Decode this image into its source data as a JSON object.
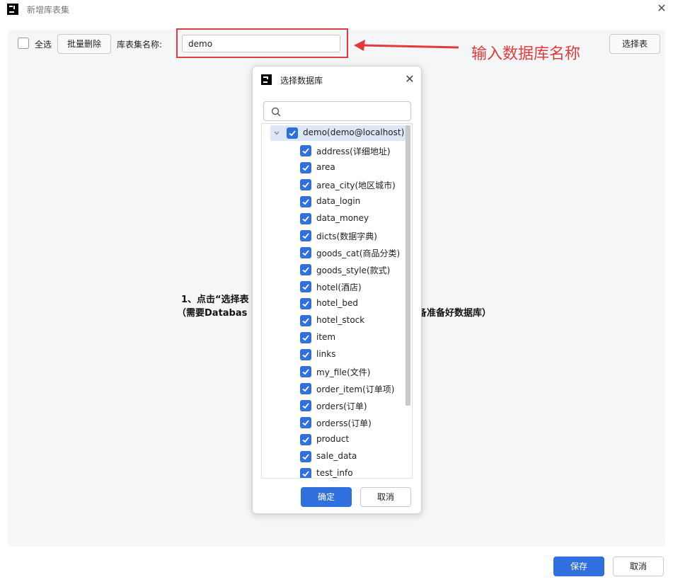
{
  "window": {
    "title": "新增库表集",
    "close_glyph": "✕"
  },
  "toolbar": {
    "select_all_label": "全选",
    "batch_delete_label": "批量删除",
    "name_label": "库表集名称:",
    "name_value": "demo",
    "select_table_label": "选择表"
  },
  "annotation": {
    "text": "输入数据库名称",
    "color": "#e33b3b"
  },
  "hint": {
    "line1": "1、点击“选择表",
    "line2_start": "（需要Databas",
    "line2_end": "备准备好数据库）"
  },
  "dialog": {
    "title": "选择数据库",
    "close_glyph": "✕",
    "search_placeholder": "",
    "root": {
      "label": "demo(demo@localhost)",
      "checked": true,
      "expanded": true
    },
    "items": [
      {
        "label": "address(详细地址)",
        "checked": true
      },
      {
        "label": "area",
        "checked": true
      },
      {
        "label": "area_city(地区城市)",
        "checked": true
      },
      {
        "label": "data_login",
        "checked": true
      },
      {
        "label": "data_money",
        "checked": true
      },
      {
        "label": "dicts(数据字典)",
        "checked": true
      },
      {
        "label": "goods_cat(商品分类)",
        "checked": true
      },
      {
        "label": "goods_style(款式)",
        "checked": true
      },
      {
        "label": "hotel(酒店)",
        "checked": true
      },
      {
        "label": "hotel_bed",
        "checked": true
      },
      {
        "label": "hotel_stock",
        "checked": true
      },
      {
        "label": "item",
        "checked": true
      },
      {
        "label": "links",
        "checked": true
      },
      {
        "label": "my_file(文件)",
        "checked": true
      },
      {
        "label": "order_item(订单项)",
        "checked": true
      },
      {
        "label": "orders(订单)",
        "checked": true
      },
      {
        "label": "orderss(订单)",
        "checked": true
      },
      {
        "label": "product",
        "checked": true
      },
      {
        "label": "sale_data",
        "checked": true
      },
      {
        "label": "test_info",
        "checked": true
      }
    ],
    "ok_label": "确定",
    "cancel_label": "取消"
  },
  "footer": {
    "save_label": "保存",
    "cancel_label": "取消"
  },
  "colors": {
    "primary": "#2f6fde",
    "highlight": "#e33b3b",
    "panel_bg": "#f5f6f7"
  }
}
